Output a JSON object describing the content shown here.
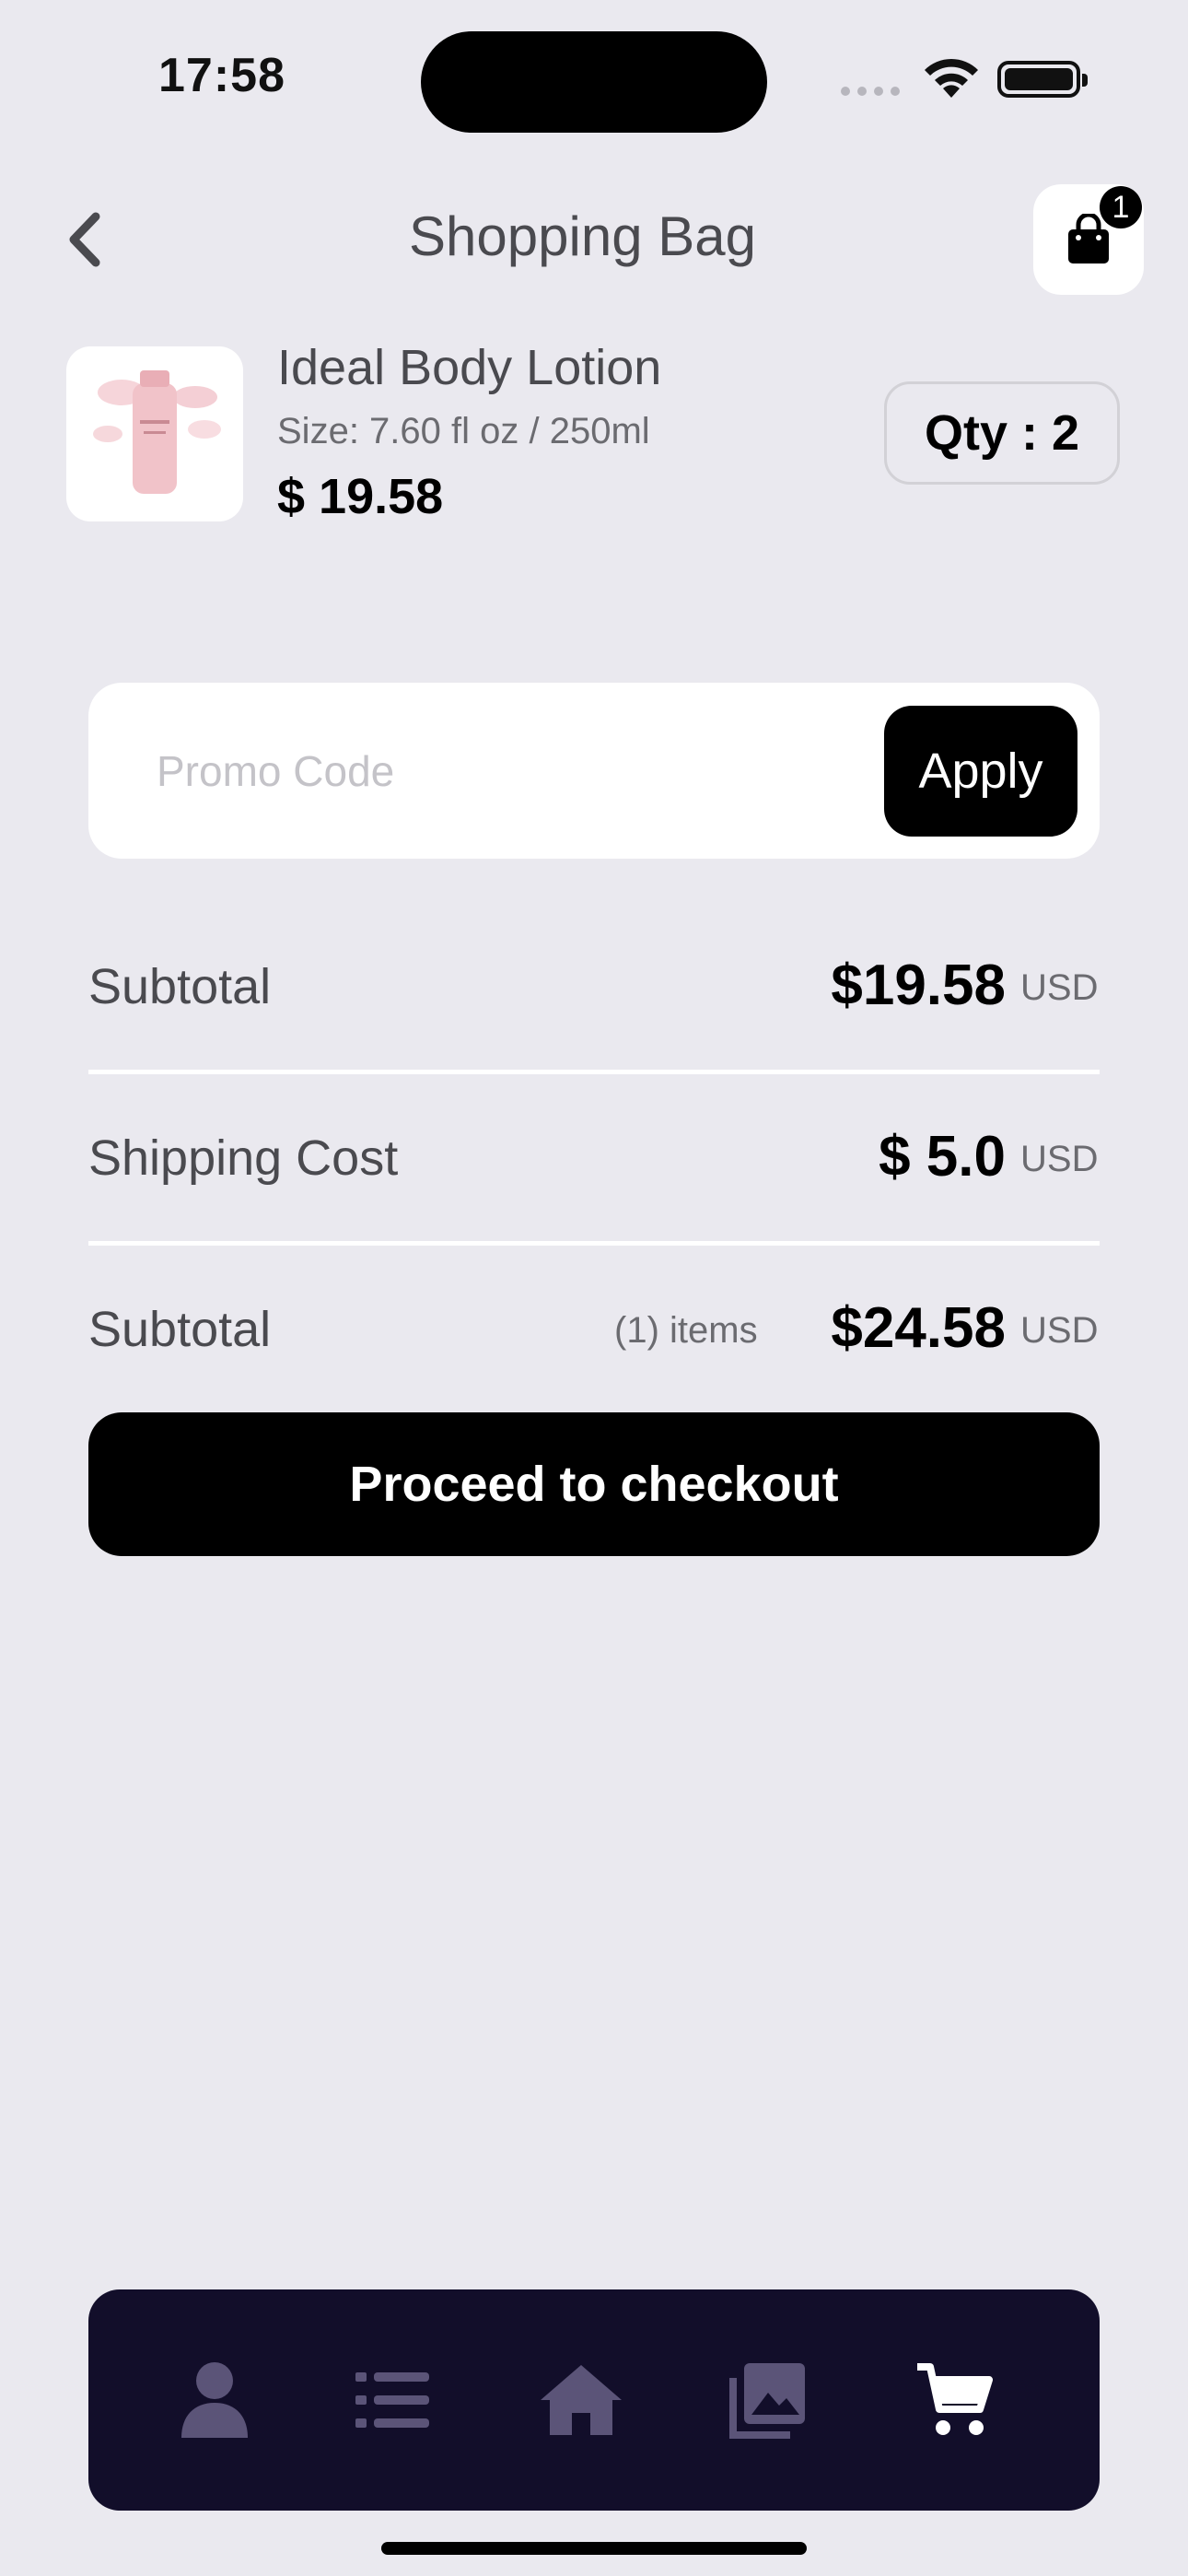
{
  "status_bar": {
    "time": "17:58"
  },
  "header": {
    "title": "Shopping Bag",
    "bag_badge": "1"
  },
  "product": {
    "name": "Ideal Body Lotion",
    "size": "Size: 7.60 fl oz / 250ml",
    "price": "$ 19.58",
    "qty": "Qty : 2"
  },
  "promo": {
    "placeholder": "Promo Code",
    "apply_label": "Apply"
  },
  "summary": {
    "subtotal_label": "Subtotal",
    "subtotal_value": "$19.58",
    "subtotal_unit": "USD",
    "shipping_label": "Shipping Cost",
    "shipping_value": "$ 5.0",
    "shipping_unit": "USD",
    "total_label": "Subtotal",
    "total_items": "(1) items",
    "total_value": "$24.58",
    "total_unit": "USD"
  },
  "checkout_label": "Proceed to checkout",
  "tab_bar": {
    "items": [
      "profile-icon",
      "list-icon",
      "home-icon",
      "gallery-icon",
      "cart-icon"
    ],
    "active": "cart-icon"
  },
  "colors": {
    "background": "#EAE9EF",
    "tab_bar": "#120E2A",
    "tab_inactive": "#5B5478",
    "accent": "#000000"
  }
}
